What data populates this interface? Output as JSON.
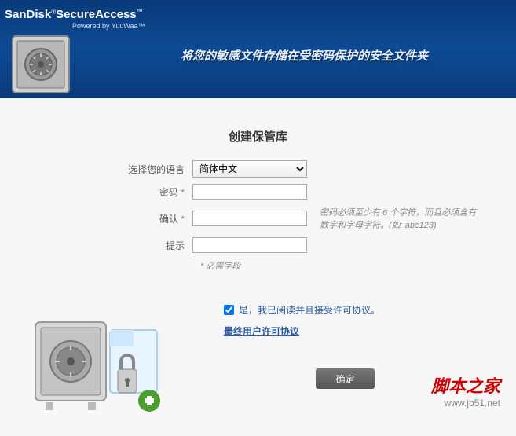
{
  "header": {
    "brand_prefix": "SanDisk",
    "brand_suffix": "SecureAccess",
    "powered": "Powered by YuuWaa™",
    "tagline": "将您的敏感文件存储在受密码保护的安全文件夹"
  },
  "form": {
    "title": "创建保管库",
    "language_label": "选择您的语言",
    "language_value": "简体中文",
    "password_label": "密码",
    "confirm_label": "确认",
    "hint_label": "提示",
    "password_value": "",
    "confirm_value": "",
    "hint_value": "",
    "password_rule": "密码必须至少有 6 个字符，而且必须含有数字和字母字符。(如: abc123)",
    "required_note": "* 必需字段",
    "required_star": "*"
  },
  "agreement": {
    "checkbox_label": "是，我已阅读并且接受许可协议。",
    "eula_link": "最终用户许可协议",
    "checked": true
  },
  "actions": {
    "ok_label": "确定"
  },
  "watermark": {
    "site_cn": "脚本之家",
    "site_url": "www.jb51.net"
  }
}
